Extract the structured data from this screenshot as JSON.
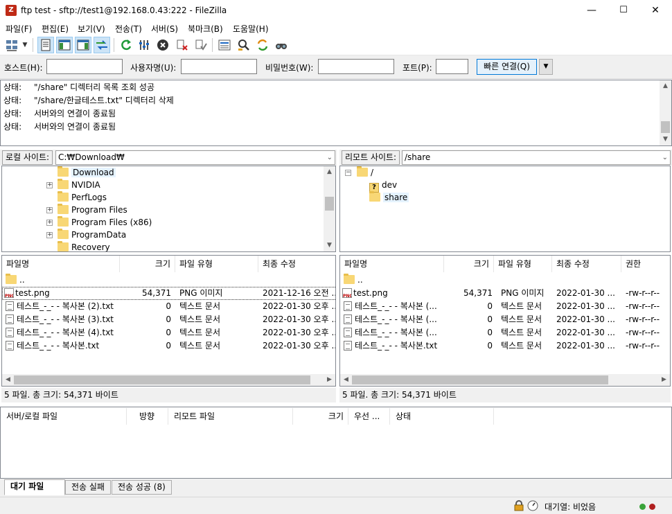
{
  "window": {
    "title": "ftp test - sftp://test1@192.168.0.43:222 - FileZilla",
    "minimize_glyph": "—",
    "maximize_glyph": "☐",
    "close_glyph": "✕"
  },
  "menu": [
    {
      "label": "파일(F)"
    },
    {
      "label": "편집(E)"
    },
    {
      "label": "보기(V)"
    },
    {
      "label": "전송(T)"
    },
    {
      "label": "서버(S)"
    },
    {
      "label": "북마크(B)"
    },
    {
      "label": "도움말(H)"
    }
  ],
  "toolbar": {
    "icons": [
      "site-manager-icon",
      "site-manager-dropdown-icon",
      "message-log-toggle-icon",
      "local-tree-toggle-icon",
      "remote-tree-toggle-icon",
      "transfer-queue-toggle-icon",
      "refresh-icon",
      "filter-settings-icon",
      "cancel-operation-icon",
      "disconnect-icon",
      "reconnect-icon",
      "directory-listing-filters-icon",
      "toggle-directory-comparison-icon",
      "synchronized-browsing-icon",
      "search-remote-files-icon"
    ]
  },
  "quickconnect": {
    "host_label": "호스트(H):",
    "user_label": "사용자명(U):",
    "pass_label": "비밀번호(W):",
    "port_label": "포트(P):",
    "host_value": "",
    "user_value": "",
    "pass_value": "",
    "port_value": "",
    "connect_label": "빠른 연결(Q)"
  },
  "log": {
    "rows": [
      {
        "label": "상태:",
        "text": "\"/share\" 디렉터리 목록 조회 성공"
      },
      {
        "label": "상태:",
        "text": "\"/share/한글테스트.txt\" 디렉터리 삭제"
      },
      {
        "label": "상태:",
        "text": "서버와의 연결이 종료됨"
      },
      {
        "label": "상태:",
        "text": "서버와의 연결이 종료됨"
      }
    ]
  },
  "local": {
    "site_label": "로컬 사이트:",
    "path": "C:₩Download₩",
    "tree": [
      {
        "name": "Download",
        "expandable": false,
        "selected": true
      },
      {
        "name": "NVIDIA",
        "expandable": true,
        "selected": false
      },
      {
        "name": "PerfLogs",
        "expandable": false,
        "selected": false
      },
      {
        "name": "Program Files",
        "expandable": true,
        "selected": false
      },
      {
        "name": "Program Files (x86)",
        "expandable": true,
        "selected": false
      },
      {
        "name": "ProgramData",
        "expandable": true,
        "selected": false
      },
      {
        "name": "Recovery",
        "expandable": false,
        "selected": false
      }
    ],
    "columns": [
      "파일명",
      "크기",
      "파일 유형",
      "최종 수정"
    ],
    "files": [
      {
        "name": "..",
        "size": "",
        "type": "",
        "modified": "",
        "kind": "folder"
      },
      {
        "name": "test.png",
        "size": "54,371",
        "type": "PNG 이미지",
        "modified": "2021-12-16 오전 ...",
        "kind": "png"
      },
      {
        "name": "테스트_-_- - 복사본 (2).txt",
        "size": "0",
        "type": "텍스트 문서",
        "modified": "2022-01-30 오후 ...",
        "kind": "txt"
      },
      {
        "name": "테스트_-_- - 복사본 (3).txt",
        "size": "0",
        "type": "텍스트 문서",
        "modified": "2022-01-30 오후 ...",
        "kind": "txt"
      },
      {
        "name": "테스트_-_- - 복사본 (4).txt",
        "size": "0",
        "type": "텍스트 문서",
        "modified": "2022-01-30 오후 ...",
        "kind": "txt"
      },
      {
        "name": "테스트_-_- - 복사본.txt",
        "size": "0",
        "type": "텍스트 문서",
        "modified": "2022-01-30 오후 ...",
        "kind": "txt"
      }
    ],
    "status": "5 파일. 총 크기: 54,371 바이트"
  },
  "remote": {
    "site_label": "리모트 사이트:",
    "path": "/share",
    "tree": [
      {
        "name": "/",
        "kind": "folder",
        "selected": false
      },
      {
        "name": "dev",
        "kind": "unknown",
        "selected": false
      },
      {
        "name": "share",
        "kind": "folder",
        "selected": true
      }
    ],
    "columns": [
      "파일명",
      "크기",
      "파일 유형",
      "최종 수정",
      "권한"
    ],
    "files": [
      {
        "name": "..",
        "size": "",
        "type": "",
        "modified": "",
        "perm": "",
        "kind": "folder"
      },
      {
        "name": "test.png",
        "size": "54,371",
        "type": "PNG 이미지",
        "modified": "2022-01-30 ...",
        "perm": "-rw-r--r--",
        "kind": "png"
      },
      {
        "name": "테스트_-_- - 복사본 (...",
        "size": "0",
        "type": "텍스트 문서",
        "modified": "2022-01-30 ...",
        "perm": "-rw-r--r--",
        "kind": "txt"
      },
      {
        "name": "테스트_-_- - 복사본 (...",
        "size": "0",
        "type": "텍스트 문서",
        "modified": "2022-01-30 ...",
        "perm": "-rw-r--r--",
        "kind": "txt"
      },
      {
        "name": "테스트_-_- - 복사본 (...",
        "size": "0",
        "type": "텍스트 문서",
        "modified": "2022-01-30 ...",
        "perm": "-rw-r--r--",
        "kind": "txt"
      },
      {
        "name": "테스트_-_- - 복사본.txt",
        "size": "0",
        "type": "텍스트 문서",
        "modified": "2022-01-30 ...",
        "perm": "-rw-r--r--",
        "kind": "txt"
      }
    ],
    "status": "5 파일. 총 크기: 54,371 바이트"
  },
  "queue": {
    "columns": [
      "서버/로컬 파일",
      "방향",
      "리모트 파일",
      "크기",
      "우선 ...",
      "상태"
    ]
  },
  "tabs": [
    {
      "label": "대기 파일",
      "active": true
    },
    {
      "label": "전송 실패",
      "active": false
    },
    {
      "label": "전송 성공 (8)",
      "active": false
    }
  ],
  "statusbar": {
    "queue_text": "대기열: 비었음"
  },
  "colors": {
    "accent": "#0078d7",
    "selection": "#e5f3ff",
    "folder": "#f8d775",
    "led_green": "#3aa33a",
    "led_red": "#b02020"
  }
}
